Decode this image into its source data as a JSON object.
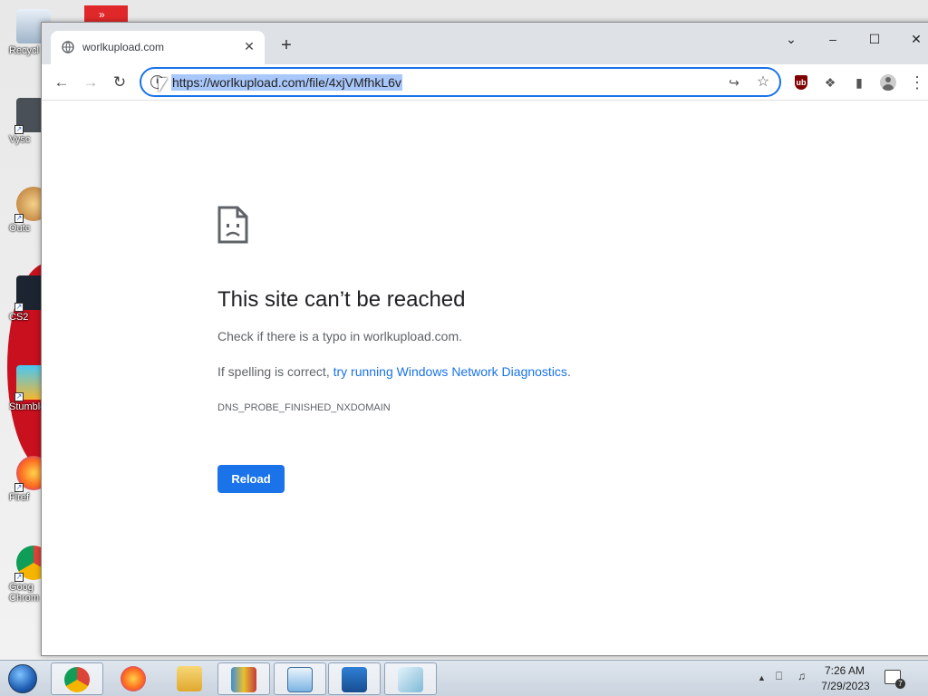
{
  "desktop": {
    "icons": [
      {
        "label": "Recycl"
      },
      {
        "label": "Vysc"
      },
      {
        "label": "Outc"
      },
      {
        "label": "CS2"
      },
      {
        "label": "Stumble"
      },
      {
        "label": "Firef"
      },
      {
        "label": "Goog Chrom"
      }
    ],
    "square_glyph": "»"
  },
  "browser": {
    "tab_title": "worlkupload.com",
    "tab_close": "✕",
    "new_tab": "+",
    "window_controls": {
      "dropdown": "⌄",
      "minimize": "–",
      "maximize": "☐",
      "close": "✕"
    },
    "nav": {
      "back": "←",
      "forward": "→",
      "reload": "↻"
    },
    "url": "https://worlkupload.com/file/4xjVMfhkL6v",
    "info_glyph": "i",
    "share_glyph": "↪",
    "star_glyph": "☆",
    "ublock_label": "ub",
    "extensions_glyph": "❖",
    "sidepanel_glyph": "▮",
    "menu_glyph": "⋮"
  },
  "error_page": {
    "title": "This site can’t be reached",
    "hint": "Check if there is a typo in worlkupload.com.",
    "spell_prefix": "If spelling is correct, ",
    "spell_link": "try running Windows Network Diagnostics",
    "spell_suffix": ".",
    "code": "DNS_PROBE_FINISHED_NXDOMAIN",
    "reload_label": "Reload"
  },
  "taskbar": {
    "time": "7:26 AM",
    "date": "7/29/2023",
    "notification_count": "7",
    "tray_up": "▲",
    "network_glyph": "⎕",
    "volume_glyph": "♫"
  },
  "colors": {
    "accent": "#1a73e8",
    "url_highlight": "#a8c7fa",
    "ublock": "#800000",
    "taskbar": "#c9d3de"
  }
}
